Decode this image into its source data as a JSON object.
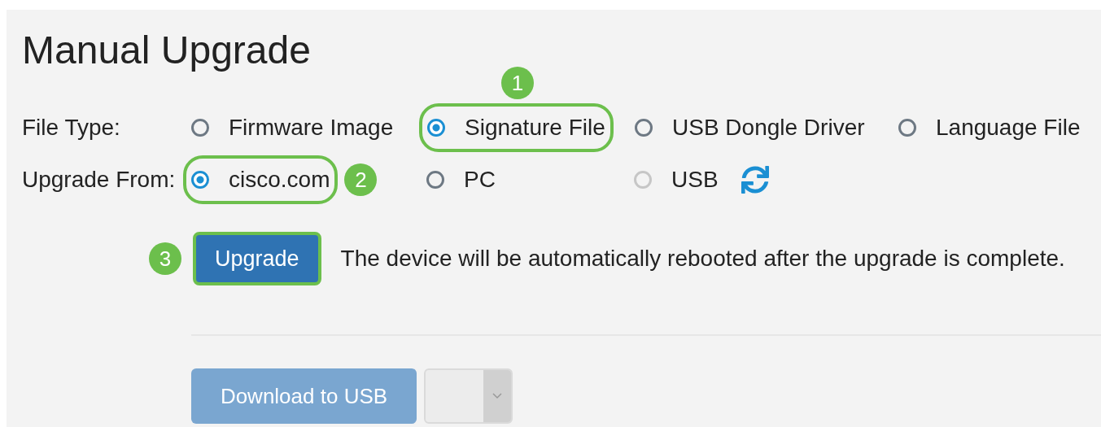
{
  "title": "Manual Upgrade",
  "fields": [
    {
      "label": "File Type:",
      "options": [
        {
          "label": "Firmware Image",
          "selected": false,
          "disabled": false,
          "highlighted": false
        },
        {
          "label": "Signature File",
          "selected": true,
          "disabled": false,
          "highlighted": true,
          "callout": {
            "number": "1"
          }
        },
        {
          "label": "USB Dongle Driver",
          "selected": false,
          "disabled": false,
          "highlighted": false
        },
        {
          "label": "Language File",
          "selected": false,
          "disabled": false,
          "highlighted": false
        }
      ]
    },
    {
      "label": "Upgrade From:",
      "options": [
        {
          "label": "cisco.com",
          "selected": true,
          "disabled": false,
          "highlighted": true,
          "callout": {
            "number": "2"
          }
        },
        {
          "label": "PC",
          "selected": false,
          "disabled": false,
          "highlighted": false
        },
        {
          "label": "USB",
          "selected": false,
          "disabled": true,
          "highlighted": false,
          "refresh": true
        }
      ]
    }
  ],
  "upgrade": {
    "button": {
      "label": "Upgrade",
      "highlighted": true,
      "callout": {
        "number": "3"
      }
    },
    "note": "The device will be automatically rebooted after the upgrade is complete."
  },
  "download": {
    "button": {
      "label": "Download to USB",
      "disabled": true
    },
    "select": {
      "disabled": true
    }
  }
}
